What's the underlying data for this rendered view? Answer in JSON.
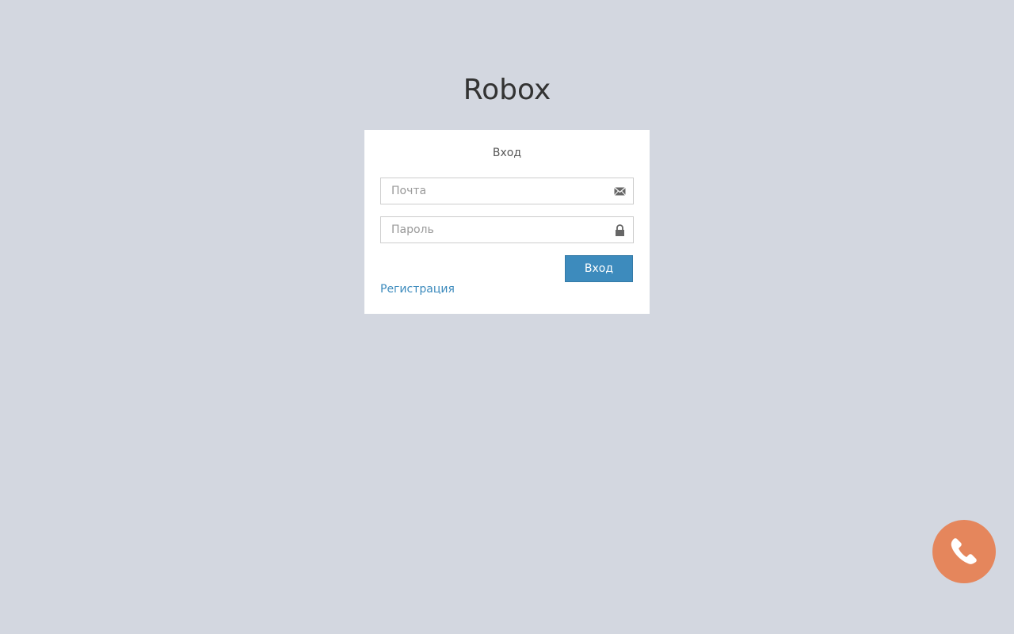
{
  "app": {
    "title": "Robox"
  },
  "login": {
    "heading": "Вход",
    "email_placeholder": "Почта",
    "password_placeholder": "Пароль",
    "submit_label": "Вход",
    "register_link": "Регистрация"
  },
  "icons": {
    "email": "envelope-icon",
    "password": "lock-icon",
    "call": "phone-icon"
  },
  "colors": {
    "background": "#d3d7e0",
    "accent": "#3d8bbd",
    "call_button": "#e5865c"
  }
}
